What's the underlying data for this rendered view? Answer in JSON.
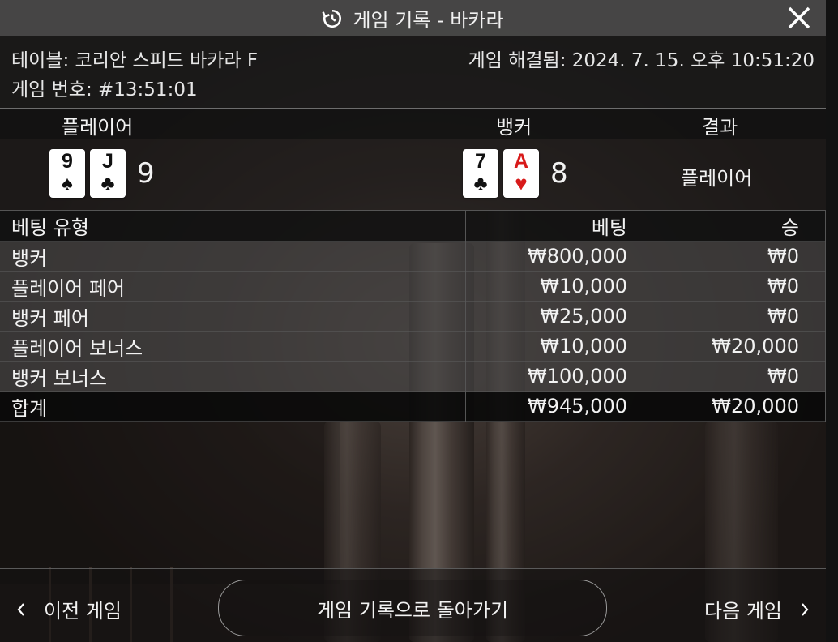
{
  "header": {
    "title": "게임 기록 - 바카라",
    "history_icon": "history-icon",
    "close_icon": "close-icon"
  },
  "info": {
    "table": "테이블: 코리안 스피드 바카라 F",
    "game_number": "게임 번호: #13:51:01",
    "resolved": "게임 해결됨: 2024. 7. 15. 오후 10:51:20"
  },
  "result": {
    "player_label": "플레이어",
    "banker_label": "뱅커",
    "outcome_label": "결과",
    "player_cards": [
      {
        "rank": "9",
        "suit": "♠",
        "color": "#111111"
      },
      {
        "rank": "J",
        "suit": "♣",
        "color": "#111111"
      }
    ],
    "player_score": "9",
    "banker_cards": [
      {
        "rank": "7",
        "suit": "♣",
        "color": "#111111"
      },
      {
        "rank": "A",
        "suit": "♥",
        "color": "#d81a1a"
      }
    ],
    "banker_score": "8",
    "outcome": "플레이어"
  },
  "bets": {
    "headers": [
      "베팅 유형",
      "베팅",
      "승"
    ],
    "rows": [
      [
        "뱅커",
        "₩800,000",
        "₩0"
      ],
      [
        "플레이어 페어",
        "₩10,000",
        "₩0"
      ],
      [
        "뱅커 페어",
        "₩25,000",
        "₩0"
      ],
      [
        "플레이어 보너스",
        "₩10,000",
        "₩20,000"
      ],
      [
        "뱅커 보너스",
        "₩100,000",
        "₩0"
      ]
    ],
    "total": [
      "합계",
      "₩945,000",
      "₩20,000"
    ]
  },
  "nav": {
    "prev": "이전 게임",
    "back": "게임 기록으로 돌아가기",
    "next": "다음 게임",
    "prev_icon": "chevron-left-icon",
    "next_icon": "chevron-right-icon"
  }
}
